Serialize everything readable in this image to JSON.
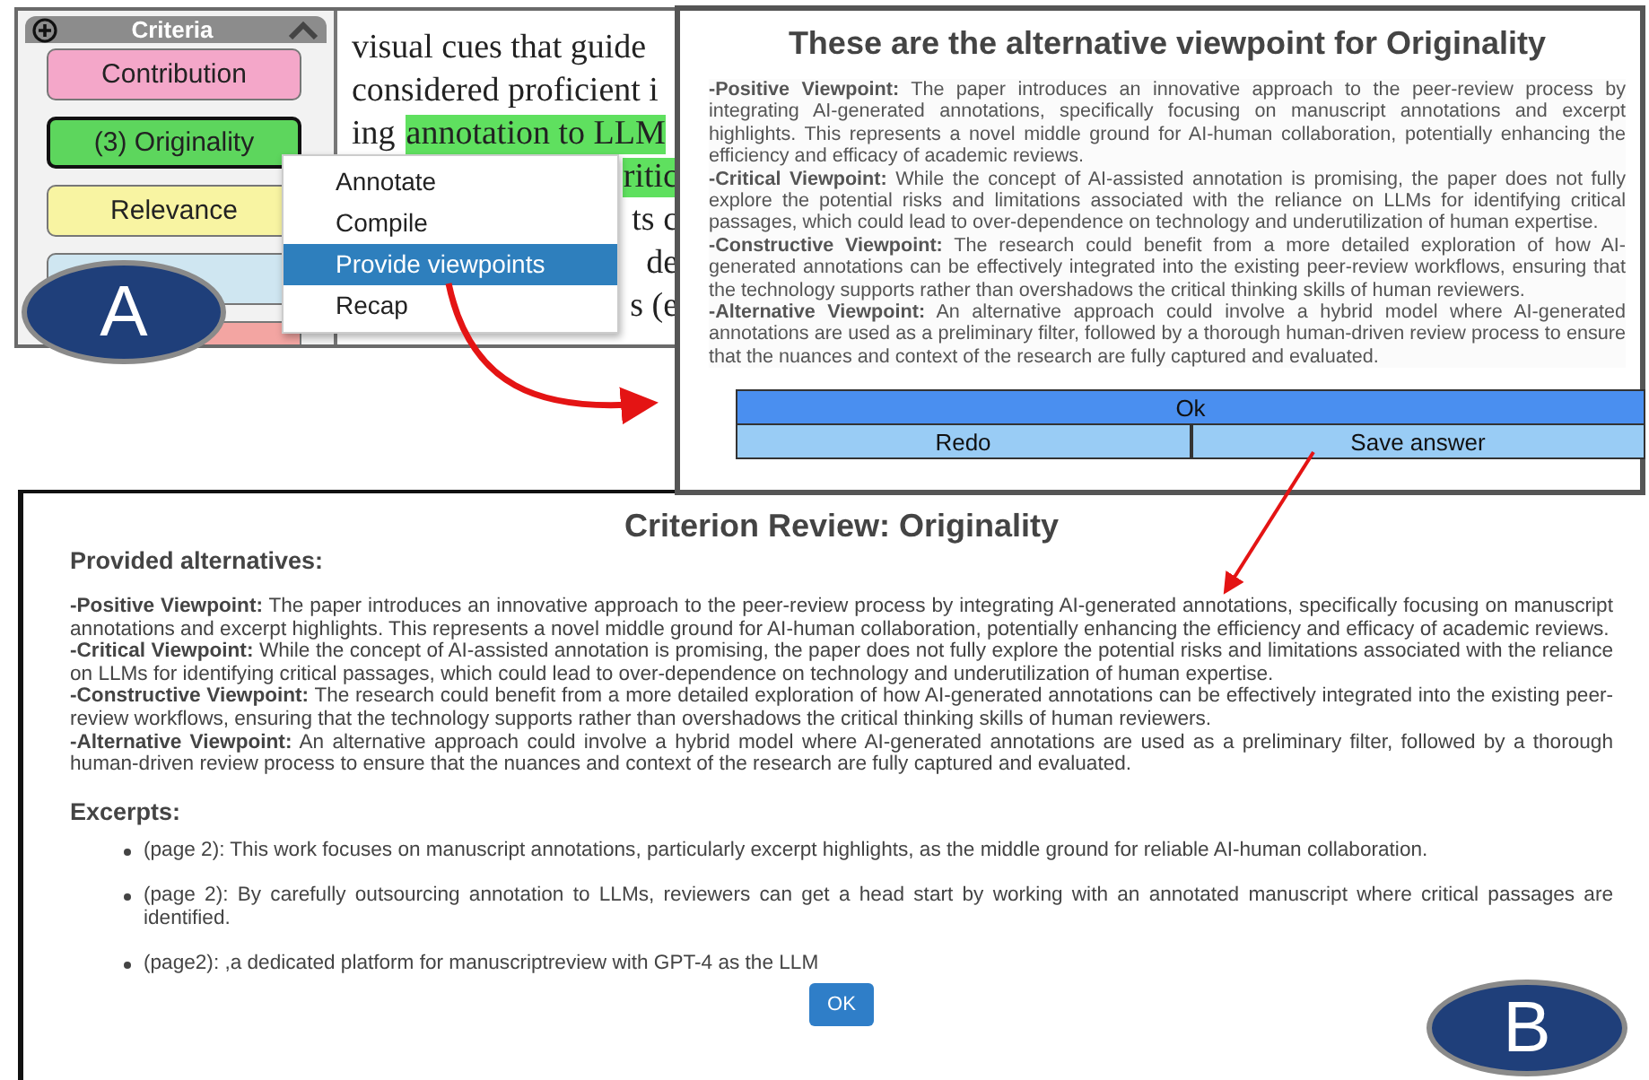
{
  "panel_a": {
    "sidebar": {
      "title": "Criteria",
      "items": [
        {
          "label": "Contribution",
          "color": "#f4a7c9",
          "selected": false
        },
        {
          "label": "(3) Originality",
          "color": "#5dd65d",
          "selected": true
        },
        {
          "label": "Relevance",
          "color": "#f8f4a2",
          "selected": false
        },
        {
          "color": "#cfe6f1",
          "selected": false
        },
        {
          "color": "#f3a5a2",
          "selected": false
        }
      ]
    },
    "document_lines": [
      {
        "kind": "full",
        "segments": [
          {
            "text": "visual cues that guide",
            "highlighted": false
          }
        ]
      },
      {
        "kind": "full",
        "segments": [
          {
            "text": "considered proficient i",
            "highlighted": false
          }
        ]
      },
      {
        "kind": "full",
        "segments": [
          {
            "text": "ing",
            "highlighted": false
          },
          {
            "text": "annotation to LLM",
            "highlighted": true
          }
        ]
      },
      {
        "kind": "tail",
        "segments": [
          {
            "text": "ritic",
            "highlighted": true
          }
        ]
      },
      {
        "kind": "tail",
        "segments": [
          {
            "text": "ts c",
            "highlighted": false
          }
        ]
      },
      {
        "kind": "tail",
        "segments": [
          {
            "text": "de",
            "highlighted": false
          }
        ]
      },
      {
        "kind": "tail",
        "segments": [
          {
            "text": "s (e",
            "highlighted": false
          }
        ]
      }
    ],
    "context_menu": {
      "items": [
        {
          "label": "Annotate",
          "selected": false
        },
        {
          "label": "Compile",
          "selected": false
        },
        {
          "label": "Provide viewpoints",
          "selected": true
        },
        {
          "label": "Recap",
          "selected": false
        }
      ]
    }
  },
  "viewpoint_dialog": {
    "title": "These are the alternative viewpoint for Originality",
    "viewpoints": [
      "**-Positive Viewpoint:** The paper introduces an innovative approach to the peer-review process by integrating AI-generated annotations, specifically focusing on manuscript annotations and excerpt highlights. This represents a novel middle ground for AI-human collaboration, potentially enhancing the efficiency and efficacy of academic reviews.",
      "**-Critical Viewpoint:** While the concept of AI-assisted annotation is promising, the paper does not fully explore the potential risks and limitations associated with the reliance on LLMs for identifying critical passages, which could lead to over-dependence on technology and underutilization of human expertise.",
      "**-Constructive Viewpoint:** The research could benefit from a more detailed exploration of how AI-generated annotations can be effectively integrated into the existing peer-review workflows, ensuring that the technology supports rather than overshadows the critical thinking skills of human reviewers.",
      "**-Alternative Viewpoint:** An alternative approach could involve a hybrid model where AI-generated annotations are used as a preliminary filter, followed by a thorough human-driven review process to ensure that the nuances and context of the research are fully captured and evaluated."
    ],
    "ok_button": "Ok",
    "redo_button": "Redo",
    "save_button": "Save answer"
  },
  "review_dialog": {
    "title": "Criterion Review: Originality",
    "alternatives_heading": "Provided alternatives:",
    "viewpoints": [
      "**-Positive Viewpoint:** The paper introduces an innovative approach to the peer-review process by integrating AI-generated annotations, specifically focusing on manuscript annotations and excerpt highlights. This represents a novel middle ground for AI-human collaboration, potentially enhancing the efficiency and efficacy of academic reviews.",
      "**-Critical Viewpoint:** While the concept of AI-assisted annotation is promising, the paper does not fully explore the potential risks and limitations associated with the reliance on LLMs for identifying critical passages, which could lead to over-dependence on technology and underutilization of human expertise.",
      "**-Constructive Viewpoint:** The research could benefit from a more detailed exploration of how AI-generated annotations can be effectively integrated into the existing peer-review workflows, ensuring that the technology supports rather than overshadows the critical thinking skills of human reviewers.",
      "**-Alternative Viewpoint:** An alternative approach could involve a hybrid model where AI-generated annotations are used as a preliminary filter, followed by a thorough human-driven review process to ensure that the nuances and context of the research are fully captured and evaluated."
    ],
    "excerpts_heading": "Excerpts:",
    "excerpts": [
      "(page 2): This work focuses on manuscript annotations, particularly excerpt highlights, as the middle ground for reliable AI-human collaboration.",
      "(page 2): By carefully outsourcing annotation to LLMs, reviewers can get a head start by working with an annotated manuscript where critical passages are identified.",
      "(page2): ,a dedicated platform for manuscriptreview with GPT-4 as the LLM"
    ],
    "ok_button": "OK"
  },
  "figure_labels": [
    "A",
    "B"
  ]
}
